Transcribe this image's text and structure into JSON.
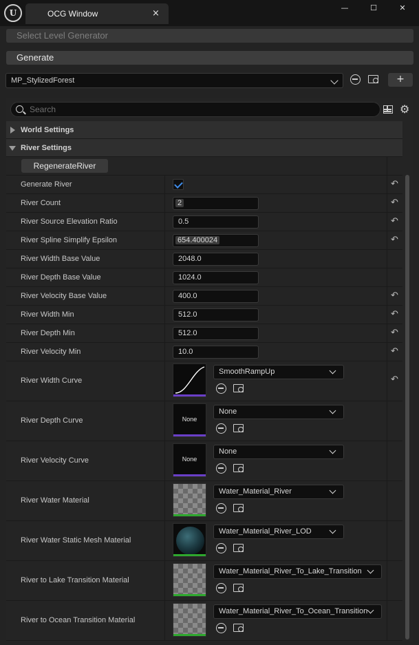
{
  "window": {
    "tab_title": "OCG Window",
    "tab_close": "×",
    "minimize": "—",
    "maximize": "☐",
    "close": "✕",
    "logo_text": "U"
  },
  "toolbar": {
    "select_generator_label": "Select Level Generator",
    "generate_label": "Generate",
    "asset_value": "MP_StylizedForest",
    "add_label": "+"
  },
  "details": {
    "search_placeholder": "Search",
    "categories": {
      "world_settings": "World Settings",
      "river_settings": "River Settings"
    },
    "regenerate_button": "RegenerateRiver",
    "reset_glyph": "↶",
    "properties": [
      {
        "label": "Generate River",
        "type": "checkbox",
        "checked": true,
        "reset": true
      },
      {
        "label": "River Count",
        "type": "number",
        "value": "2",
        "highlight": true,
        "reset": true
      },
      {
        "label": "River Source Elevation Ratio",
        "type": "number",
        "value": "0.5",
        "highlight": false,
        "reset": true
      },
      {
        "label": "River Spline Simplify Epsilon",
        "type": "number",
        "value": "654.400024",
        "highlight": true,
        "reset": true
      },
      {
        "label": "River Width Base Value",
        "type": "number",
        "value": "2048.0",
        "highlight": false,
        "reset": false
      },
      {
        "label": "River Depth Base Value",
        "type": "number",
        "value": "1024.0",
        "highlight": false,
        "reset": false
      },
      {
        "label": "River Velocity Base Value",
        "type": "number",
        "value": "400.0",
        "highlight": false,
        "reset": true
      },
      {
        "label": "River Width Min",
        "type": "number",
        "value": "512.0",
        "highlight": false,
        "reset": true
      },
      {
        "label": "River Depth Min",
        "type": "number",
        "value": "512.0",
        "highlight": false,
        "reset": true
      },
      {
        "label": "River Velocity Min",
        "type": "number",
        "value": "10.0",
        "highlight": false,
        "reset": true
      }
    ],
    "assets": [
      {
        "label": "River Width Curve",
        "thumb": "curve",
        "value": "SmoothRampUp",
        "bar_color": "#6a3fc8",
        "reset": true
      },
      {
        "label": "River Depth Curve",
        "thumb": "none",
        "thumb_text": "None",
        "value": "None",
        "bar_color": "#6a3fc8",
        "reset": false
      },
      {
        "label": "River Velocity Curve",
        "thumb": "none",
        "thumb_text": "None",
        "value": "None",
        "bar_color": "#6a3fc8",
        "reset": false
      },
      {
        "label": "River Water Material",
        "thumb": "checker",
        "value": "Water_Material_River",
        "bar_color": "#2ea82e",
        "reset": false
      },
      {
        "label": "River Water Static Mesh Material",
        "thumb": "sphere",
        "value": "Water_Material_River_LOD",
        "bar_color": "#2ea82e",
        "reset": false
      },
      {
        "label": "River to Lake Transition Material",
        "thumb": "checker",
        "value": "Water_Material_River_To_Lake_Transition",
        "bar_color": "#2ea82e",
        "reset": false
      },
      {
        "label": "River to Ocean Transition Material",
        "thumb": "checker",
        "value": "Water_Material_River_To_Ocean_Transition",
        "bar_color": "#2ea82e",
        "reset": false
      }
    ]
  }
}
